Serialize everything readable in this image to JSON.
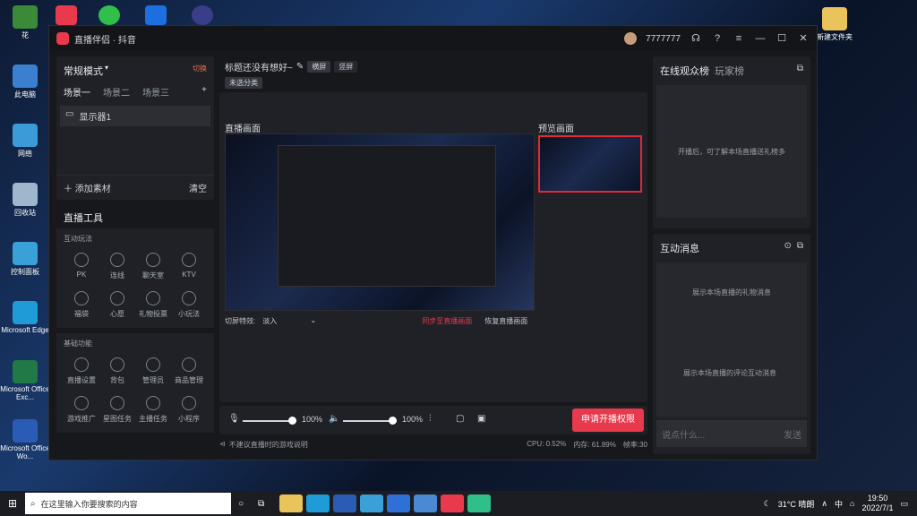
{
  "desktop_icons": [
    {
      "label": "花",
      "color": "#3a8a3a"
    },
    {
      "label": "此电脑",
      "color": "#3b7fd1"
    },
    {
      "label": "网络",
      "color": "#3b9bd9"
    },
    {
      "label": "回收站",
      "color": "#9fb7cc"
    },
    {
      "label": "控制面板",
      "color": "#3aa0d8"
    },
    {
      "label": "Microsoft Edge",
      "color": "#1f9bd7"
    },
    {
      "label": "Microsoft Office Exc...",
      "color": "#1f7a45"
    },
    {
      "label": "Microsoft Office Wo...",
      "color": "#2a5bb5"
    }
  ],
  "desktop_right_icon": {
    "label": "新建文件夹"
  },
  "window": {
    "title": "直播伴侣 · 抖音",
    "username": "7777777",
    "left": {
      "mode": "常规模式",
      "mode_switch": "切换",
      "scenes": [
        "场景一",
        "场景二",
        "场景三"
      ],
      "source": "显示器1",
      "add_source": "添加素材",
      "clear": "清空",
      "tools_title": "直播工具",
      "interactive_title": "互动玩法",
      "interactive": [
        "PK",
        "连线",
        "聊天室",
        "KTV",
        "福袋",
        "心愿",
        "礼物投票",
        "小玩法"
      ],
      "basic_title": "基础功能",
      "basic": [
        "直播设置",
        "背包",
        "管理员",
        "商品管理",
        "游戏推广",
        "星图任务",
        "主播任务",
        "小程序"
      ]
    },
    "center": {
      "title_placeholder": "标题还没有想好~",
      "orient_h": "横屏",
      "orient_v": "竖屏",
      "category": "未选分类",
      "live_label": "直播画面",
      "preview_label": "预览画面",
      "transition_label": "切屏特效:",
      "transition_value": "淡入",
      "sync_btn": "同步至直播画面",
      "restore_btn": "恢复直播画面",
      "mic_volume": "100%",
      "spk_volume": "100%",
      "mic_level": 1.0,
      "spk_level": 1.0,
      "start_btn": "申请开播权限",
      "notice": "不建议直播时的游戏说明",
      "cpu": "CPU: 0.52%",
      "mem": "内存: 61.89%",
      "fps": "帧率:30"
    },
    "right": {
      "tab_online": "在线观众榜",
      "tab_players": "玩家榜",
      "online_empty": "开播后，可了解本场直播送礼榜多",
      "interact_title": "互动消息",
      "gift_empty": "展示本场直播的礼物消息",
      "comment_empty": "展示本场直播的评论互动消息",
      "chat_placeholder": "说点什么...",
      "send": "发送"
    }
  },
  "taskbar": {
    "search_placeholder": "在这里输入你要搜索的内容",
    "weather": "31°C 晴朗",
    "ime": "中",
    "time": "19:50",
    "date": "2022/7/1"
  }
}
